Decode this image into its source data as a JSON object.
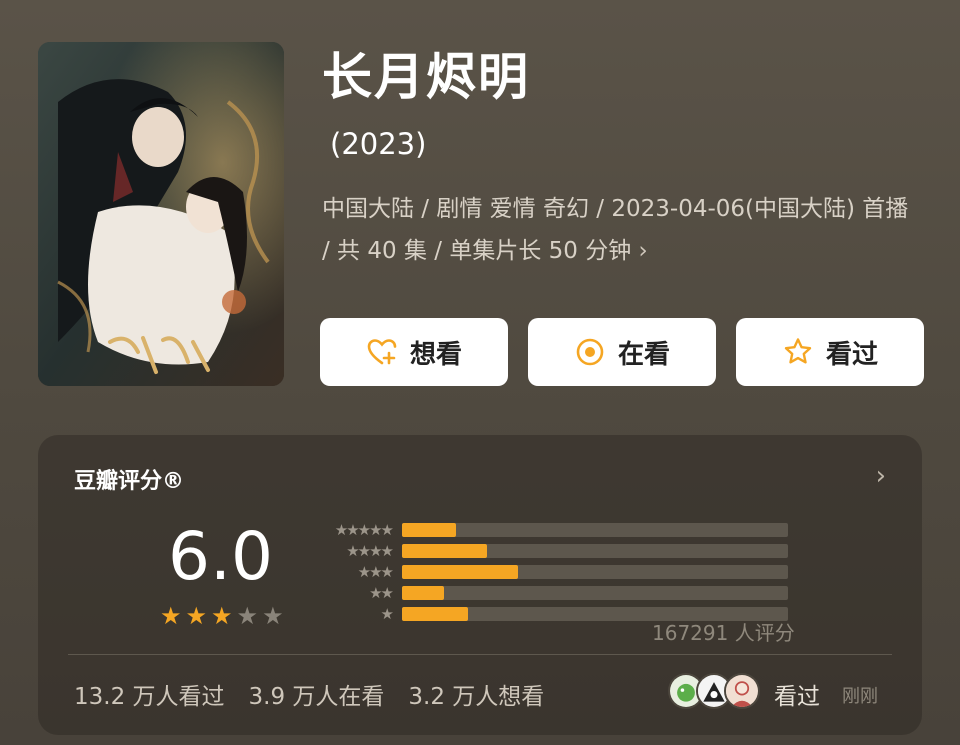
{
  "poster": {
    "alt_text": "长月烬明"
  },
  "title": "长月烬明",
  "year": "(2023)",
  "meta": {
    "line": "中国大陆 / 剧情 爱情 奇幻 / 2023-04-06(中国大陆) 首播 / 共 40 集 / 单集片长 50 分钟",
    "chevron": "›"
  },
  "actions": [
    {
      "label": "想看",
      "icon": "heart-plus-icon"
    },
    {
      "label": "在看",
      "icon": "target-icon"
    },
    {
      "label": "看过",
      "icon": "star-outline-icon"
    }
  ],
  "rating": {
    "title": "豆瓣评分®",
    "score": "6.0",
    "stars_filled": 3,
    "stars_total": 5,
    "distribution": [
      {
        "stars": 5,
        "fraction": 0.14
      },
      {
        "stars": 4,
        "fraction": 0.22
      },
      {
        "stars": 3,
        "fraction": 0.3
      },
      {
        "stars": 2,
        "fraction": 0.11
      },
      {
        "stars": 1,
        "fraction": 0.17
      }
    ],
    "count_text": "167291 人评分"
  },
  "stats": {
    "watched": "13.2 万人看过",
    "watching": "3.9 万人在看",
    "want": "3.2 万人想看"
  },
  "recent": {
    "label": "看过",
    "time": "刚刚"
  },
  "colors": {
    "accent": "#f5a623",
    "background": "#544d43"
  }
}
